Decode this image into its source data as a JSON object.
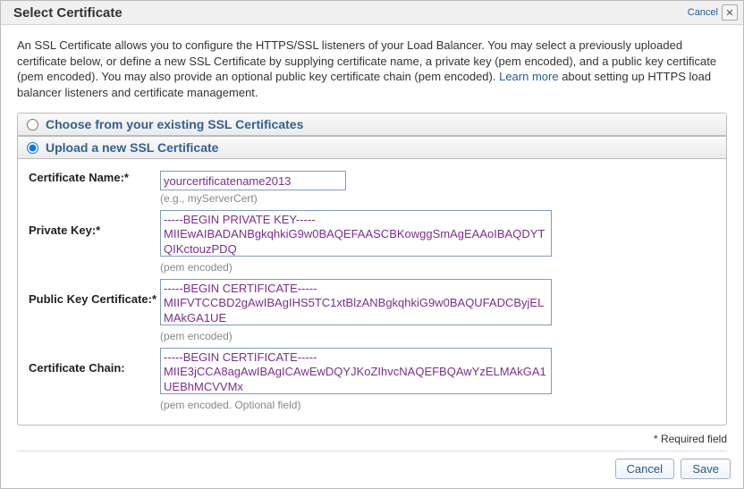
{
  "titlebar": {
    "title": "Select Certificate",
    "cancel_link": "Cancel"
  },
  "intro": {
    "pre": "An SSL Certificate allows you to configure the HTTPS/SSL listeners of your Load Balancer. You may select a previously uploaded certificate below, or define a new SSL Certificate by supplying certificate name, a private key (pem encoded), and a public key certificate (pem encoded). You may also provide an optional public key certificate chain (pem encoded). ",
    "link_text": "Learn more",
    "post": " about setting up HTTPS load balancer listeners and certificate management."
  },
  "sections": {
    "existing_label": "Choose from your existing SSL Certificates",
    "upload_label": "Upload a new SSL Certificate"
  },
  "form": {
    "cert_name": {
      "label": "Certificate Name:*",
      "value": "yourcertificatename2013",
      "hint": "(e.g., myServerCert)"
    },
    "private_key": {
      "label": "Private Key:*",
      "value": "-----BEGIN PRIVATE KEY-----\nMIIEwAIBADANBgkqhkiG9w0BAQEFAASCBKowggSmAgEAAoIBAQDYTQIKctouzPDQ",
      "hint": "(pem encoded)"
    },
    "public_key": {
      "label": "Public Key Certificate:*",
      "value": "-----BEGIN CERTIFICATE-----\nMIIFVTCCBD2gAwIBAgIHS5TC1xtBlzANBgkqhkiG9w0BAQUFADCByjELMAkGA1UE",
      "hint": "(pem encoded)"
    },
    "chain": {
      "label": "Certificate Chain:",
      "value": "-----BEGIN CERTIFICATE-----\nMIIE3jCCA8agAwIBAgICAwEwDQYJKoZIhvcNAQEFBQAwYzELMAkGA1UEBhMCVVMx",
      "hint": "(pem encoded. Optional field)"
    }
  },
  "required_note": "* Required field",
  "buttons": {
    "cancel": "Cancel",
    "save": "Save"
  }
}
